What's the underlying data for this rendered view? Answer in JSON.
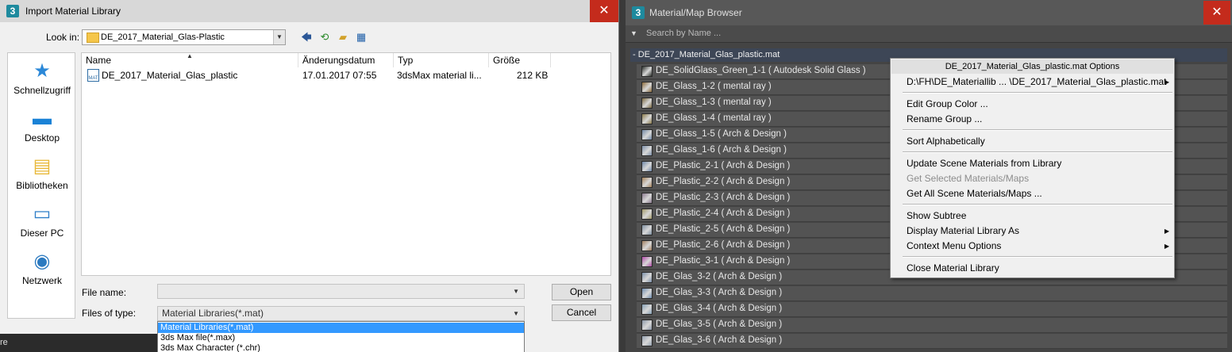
{
  "left_dialog": {
    "title": "Import Material Library",
    "app_icon": "3",
    "close": "✕",
    "look_in_label": "Look in:",
    "look_in_value": "DE_2017_Material_Glas-Plastic",
    "places": [
      "Schnellzugriff",
      "Desktop",
      "Bibliotheken",
      "Dieser PC",
      "Netzwerk"
    ],
    "columns": [
      "Name",
      "Änderungsdatum",
      "Typ",
      "Größe"
    ],
    "file": {
      "icon_text": "MAT",
      "name": "DE_2017_Material_Glas_plastic",
      "date": "17.01.2017 07:55",
      "type": "3dsMax material li...",
      "size": "212 KB"
    },
    "file_name_label": "File name:",
    "file_name_value": "",
    "files_of_type_label": "Files of type:",
    "files_of_type_value": "Material Libraries(*.mat)",
    "open_label": "Open",
    "cancel_label": "Cancel",
    "type_options": [
      "Material Libraries(*.mat)",
      "3ds Max file(*.max)",
      "3ds Max Character (*.chr)"
    ],
    "strip_text": "re"
  },
  "right_panel": {
    "title": "Material/Map Browser",
    "app_icon": "3",
    "close": "✕",
    "search_placeholder": "Search by Name ...",
    "group_name": "- DE_2017_Material_Glas_plastic.mat",
    "materials": [
      {
        "name": "DE_SolidGlass_Green_1-1 ( Autodesk Solid Glass )",
        "color": "#2b2f2b"
      },
      {
        "name": "DE_Glass_1-2  ( mental ray )",
        "color": "#8a6a3a"
      },
      {
        "name": "DE_Glass_1-3  ( mental ray )",
        "color": "#7a6840"
      },
      {
        "name": "DE_Glass_1-4  ( mental ray )",
        "color": "#8a7a4a"
      },
      {
        "name": "DE_Glass_1-5  ( Arch & Design )",
        "color": "#6f86a3"
      },
      {
        "name": "DE_Glass_1-6  ( Arch & Design )",
        "color": "#7d8fa8"
      },
      {
        "name": "DE_Plastic_2-1  ( Arch & Design )",
        "color": "#6e86a6"
      },
      {
        "name": "DE_Plastic_2-2  ( Arch & Design )",
        "color": "#a5825a"
      },
      {
        "name": "DE_Plastic_2-3  ( Arch & Design )",
        "color": "#8a7a8e"
      },
      {
        "name": "DE_Plastic_2-4  ( Arch & Design )",
        "color": "#a39a6a"
      },
      {
        "name": "DE_Plastic_2-5  ( Arch & Design )",
        "color": "#7e8fa0"
      },
      {
        "name": "DE_Plastic_2-6  ( Arch & Design )",
        "color": "#a07e5e"
      },
      {
        "name": "DE_Plastic_3-1  ( Arch & Design )",
        "color": "#b04aa8"
      },
      {
        "name": "DE_Glas_3-2  ( Arch & Design )",
        "color": "#7b8fa8"
      },
      {
        "name": "DE_Glas_3-3  ( Arch & Design )",
        "color": "#6f8db0"
      },
      {
        "name": "DE_Glas_3-4  ( Arch & Design )",
        "color": "#86a0b6"
      },
      {
        "name": "DE_Glas_3-5  ( Arch & Design )",
        "color": "#8c97a8"
      },
      {
        "name": "DE_Glas_3-6  ( Arch & Design )",
        "color": "#95a1b0"
      }
    ],
    "context_menu": {
      "header": "DE_2017_Material_Glas_plastic.mat Options",
      "path": "D:\\FH\\DE_Materiallib ... \\DE_2017_Material_Glas_plastic.mat",
      "edit_group_color": "Edit Group Color ...",
      "rename_group": "Rename Group ...",
      "sort_alphabetically": "Sort Alphabetically",
      "update_scene": "Update Scene Materials from Library",
      "get_selected": "Get Selected Materials/Maps",
      "get_all": "Get All Scene Materials/Maps ...",
      "show_subtree": "Show Subtree",
      "display_as": "Display Material Library As",
      "context_options": "Context Menu Options",
      "close_library": "Close Material Library"
    }
  }
}
